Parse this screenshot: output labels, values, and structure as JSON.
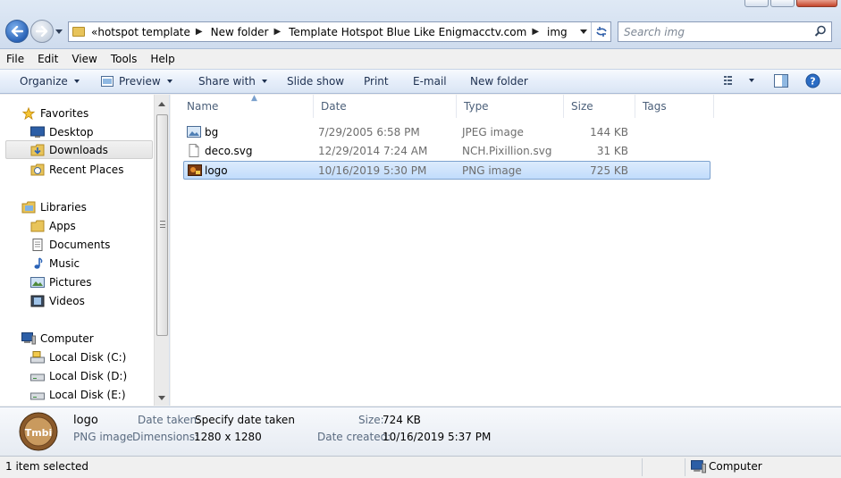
{
  "navigation": {
    "breadcrumb": [
      "hotspot template",
      "New folder",
      "Template Hotspot Blue Like Enigmacctv.com",
      "img"
    ],
    "overflow_marker": "«",
    "search_placeholder": "Search img"
  },
  "menu": [
    "File",
    "Edit",
    "View",
    "Tools",
    "Help"
  ],
  "toolbar": {
    "organize": "Organize",
    "preview": "Preview",
    "share_with": "Share with",
    "slide_show": "Slide show",
    "print": "Print",
    "email": "E-mail",
    "new_folder": "New folder"
  },
  "sidebar": {
    "favorites": {
      "label": "Favorites",
      "items": [
        "Desktop",
        "Downloads",
        "Recent Places"
      ]
    },
    "libraries": {
      "label": "Libraries",
      "items": [
        "Apps",
        "Documents",
        "Music",
        "Pictures",
        "Videos"
      ]
    },
    "computer": {
      "label": "Computer",
      "items": [
        "Local Disk (C:)",
        "Local Disk (D:)",
        "Local Disk (E:)"
      ]
    },
    "selected": "Downloads"
  },
  "columns": [
    "Name",
    "Date",
    "Type",
    "Size",
    "Tags"
  ],
  "files": [
    {
      "name": "bg",
      "date": "7/29/2005 6:58 PM",
      "type": "JPEG image",
      "size": "144 KB",
      "icon": "image-file-icon"
    },
    {
      "name": "deco.svg",
      "date": "12/29/2014 7:24 AM",
      "type": "NCH.Pixillion.svg",
      "size": "31 KB",
      "icon": "blank-file-icon"
    },
    {
      "name": "logo",
      "date": "10/16/2019 5:30 PM",
      "type": "PNG image",
      "size": "725 KB",
      "icon": "png-file-icon"
    }
  ],
  "selected_file": "logo",
  "details": {
    "name": "logo",
    "kind": "PNG image",
    "date_taken_label": "Date taken:",
    "date_taken_value": "Specify date taken",
    "dimensions_label": "Dimensions:",
    "dimensions_value": "1280 x 1280",
    "size_label": "Size:",
    "size_value": "724 KB",
    "date_created_label": "Date created:",
    "date_created_value": "10/16/2019 5:37 PM",
    "thumbnail_text": "Tmbi"
  },
  "status": {
    "selection": "1 item selected",
    "location": "Computer"
  },
  "colors": {
    "accent": "#2a63b7",
    "selection_bg": "#c1dcfc",
    "selection_border": "#7da2ce",
    "header_text": "#4c607a"
  }
}
